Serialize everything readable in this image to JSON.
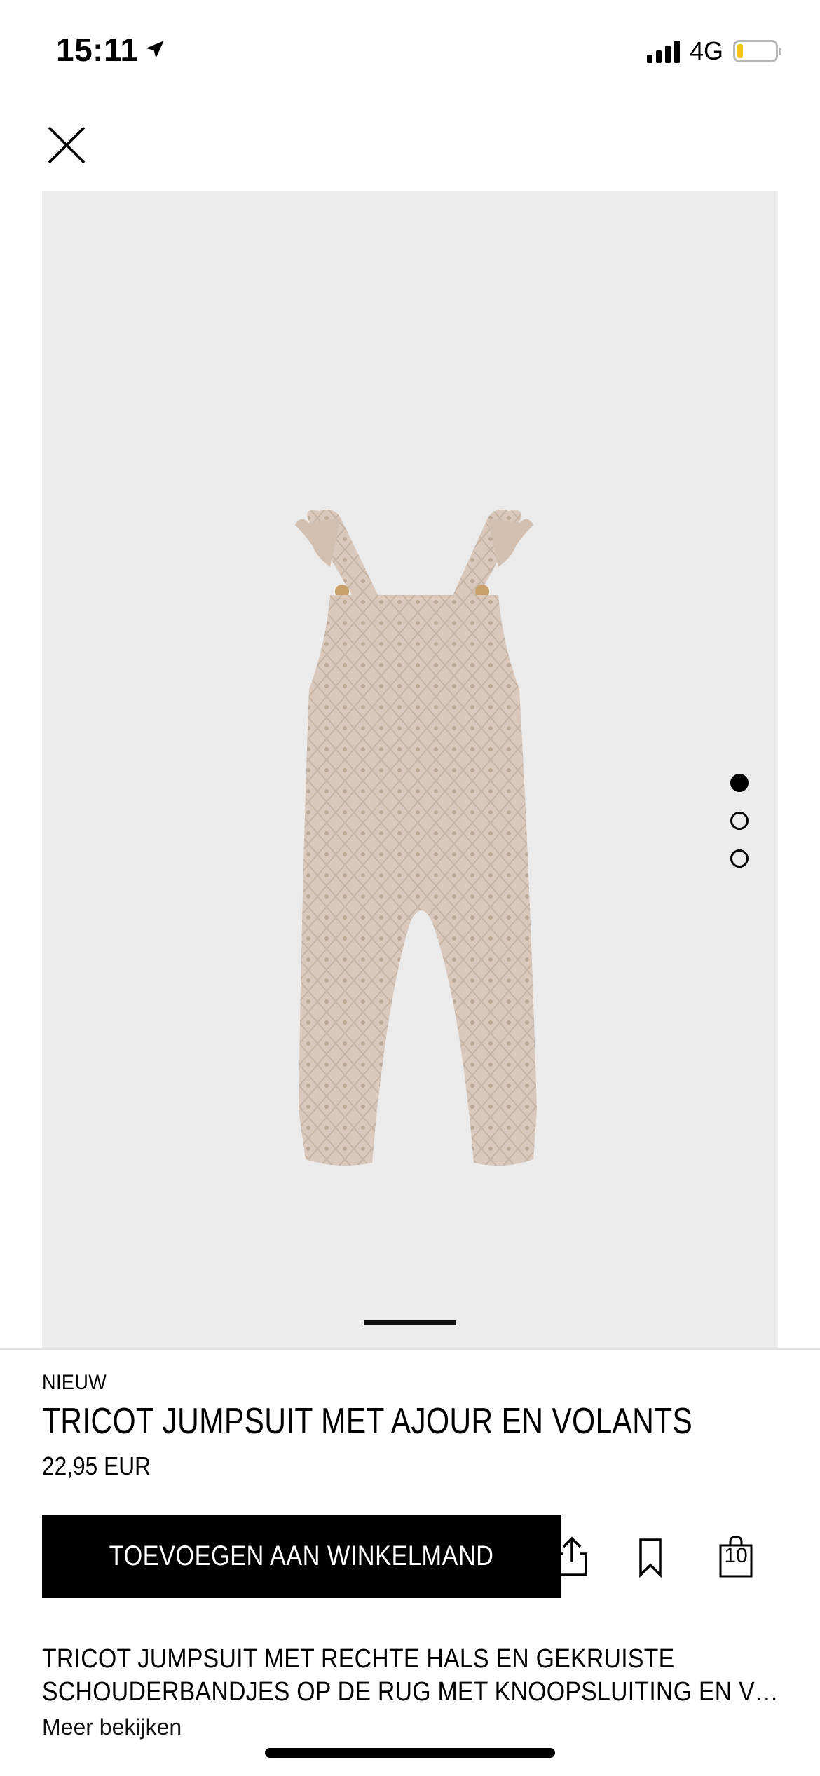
{
  "status_bar": {
    "time": "15:11",
    "network": "4G",
    "location_icon": "location-arrow-icon",
    "signal_icon": "signal-bars-icon",
    "battery_icon": "battery-low-icon",
    "battery_level": 0.15,
    "battery_color": "#f5c518"
  },
  "header": {
    "close_icon": "close-icon"
  },
  "gallery": {
    "image_alt": "tricot jumpsuit product photo",
    "image_background": "#ebebeb",
    "garment_color": "#d9c8bb",
    "page_count": 3,
    "active_page": 1
  },
  "product": {
    "badge": "NIEUW",
    "title": "TRICOT JUMPSUIT MET AJOUR EN VOLANTS",
    "price": "22,95 EUR",
    "add_to_cart_label": "TOEVOEGEN AAN WINKELMAND",
    "description_line1": "TRICOT JUMPSUIT MET RECHTE HALS EN GEKRUISTE",
    "description_line2": "SCHOUDERBANDJES OP DE RUG MET KNOOPSLUITING EN VOLANTS",
    "see_more_label": "Meer bekijken"
  },
  "actions": {
    "share_icon": "share-icon",
    "bookmark_icon": "bookmark-icon",
    "bag_icon": "shopping-bag-icon",
    "bag_count": "10"
  }
}
